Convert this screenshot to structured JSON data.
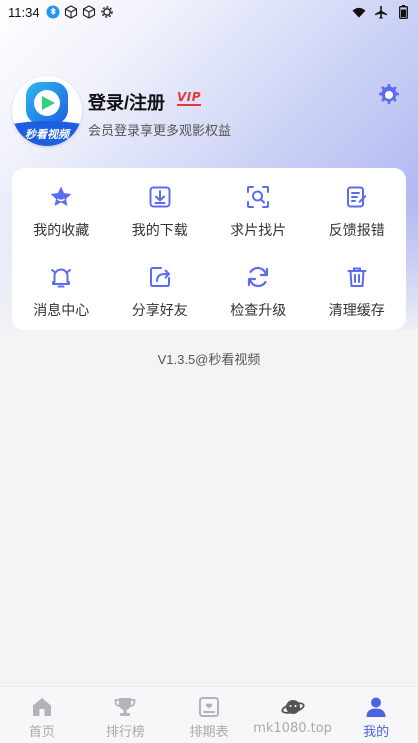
{
  "status_bar": {
    "time": "11:34",
    "left_icons": [
      "bluetooth-badge-icon",
      "cube-icon",
      "cube-icon",
      "settings-small-icon"
    ],
    "right_icons": [
      "wifi-icon",
      "airplane-icon",
      "battery-icon"
    ]
  },
  "profile": {
    "title": "登录/注册",
    "vip_label": "VIP",
    "subtitle": "会员登录享更多观影权益",
    "avatar_caption": "秒看视频"
  },
  "menu": [
    {
      "label": "我的收藏",
      "icon": "star-icon"
    },
    {
      "label": "我的下载",
      "icon": "download-icon"
    },
    {
      "label": "求片找片",
      "icon": "search-scan-icon"
    },
    {
      "label": "反馈报错",
      "icon": "feedback-edit-icon"
    },
    {
      "label": "消息中心",
      "icon": "bell-icon"
    },
    {
      "label": "分享好友",
      "icon": "share-icon"
    },
    {
      "label": "检查升级",
      "icon": "refresh-icon"
    },
    {
      "label": "清理缓存",
      "icon": "trash-icon"
    }
  ],
  "version": "V1.3.5@秒看视频",
  "bottom_nav": [
    {
      "label": "首页",
      "icon": "home-icon",
      "active": false
    },
    {
      "label": "排行榜",
      "icon": "trophy-icon",
      "active": false
    },
    {
      "label": "排期表",
      "icon": "schedule-icon",
      "active": false
    },
    {
      "label": "mk1080.top",
      "icon": "planet-icon",
      "active": false
    },
    {
      "label": "我的",
      "icon": "user-icon",
      "active": true
    }
  ],
  "colors": {
    "accent": "#4a63e0",
    "icon_blue": "#5b6cf0",
    "inactive": "#aaaaaa",
    "vip_red": "#e53935"
  }
}
